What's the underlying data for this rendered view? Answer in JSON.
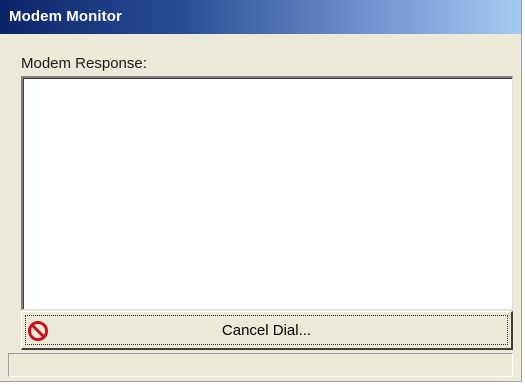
{
  "window": {
    "title": "Modem Monitor"
  },
  "response": {
    "label": "Modem Response:",
    "content": ""
  },
  "cancel_button": {
    "label": "Cancel Dial...",
    "icon": "prohibited-icon"
  },
  "statusbar": {
    "text": ""
  },
  "colors": {
    "titlebar_start": "#0a246a",
    "titlebar_end": "#a6caf0",
    "face": "#ece9d8",
    "icon_red": "#c8101e"
  }
}
